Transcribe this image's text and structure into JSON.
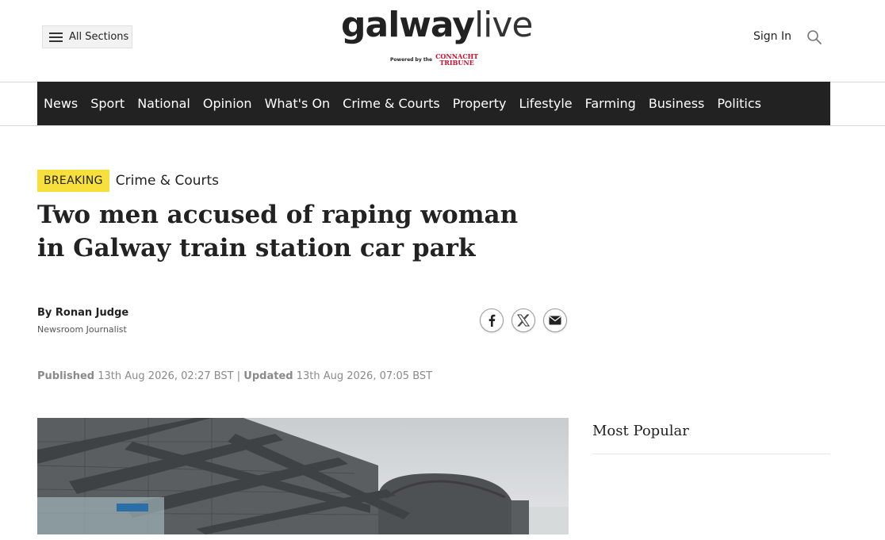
{
  "header": {
    "sections_label": "All Sections",
    "logo_bold": "galway",
    "logo_light": "live",
    "powered_by": "Powered by the",
    "partner_line1": "CONNACHT",
    "partner_line2": "TRIBUNE",
    "sign_in": "Sign In",
    "search_icon": "search-icon"
  },
  "nav": {
    "items": [
      "News",
      "Sport",
      "National",
      "Opinion",
      "What's On",
      "Crime & Courts",
      "Property",
      "Lifestyle",
      "Farming",
      "Business",
      "Politics"
    ]
  },
  "article": {
    "badge": "BREAKING",
    "section": "Crime & Courts",
    "headline": "Two men accused of raping woman in Galway train station car park",
    "byline_prefix": "By",
    "author": "Ronan Judge",
    "author_role": "Newsroom Journalist",
    "share": [
      "facebook-icon",
      "x-icon",
      "email-icon"
    ],
    "published_label": "Published",
    "published_date": "13th Aug 2026, 02:27 BST",
    "separator": "|",
    "updated_label": "Updated",
    "updated_date": "13th Aug 2026, 07:05 BST"
  },
  "sidebar": {
    "most_popular": "Most Popular"
  },
  "colors": {
    "nav_bg": "#222222",
    "breaking_bg": "#f7e03c",
    "tribune_red": "#c8102e"
  }
}
